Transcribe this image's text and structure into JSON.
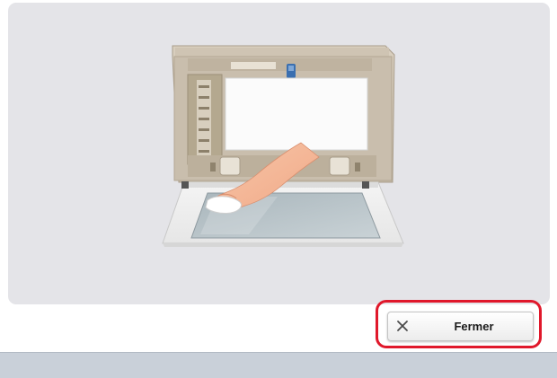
{
  "dialog": {
    "illustration": "cleaning-document-glass-illustration",
    "close_button": {
      "label": "Fermer",
      "icon": "close-icon"
    }
  },
  "colors": {
    "panel_background": "#e4e4e8",
    "highlight_border": "#e0182b",
    "bottom_bar": "#c9d0d9"
  }
}
